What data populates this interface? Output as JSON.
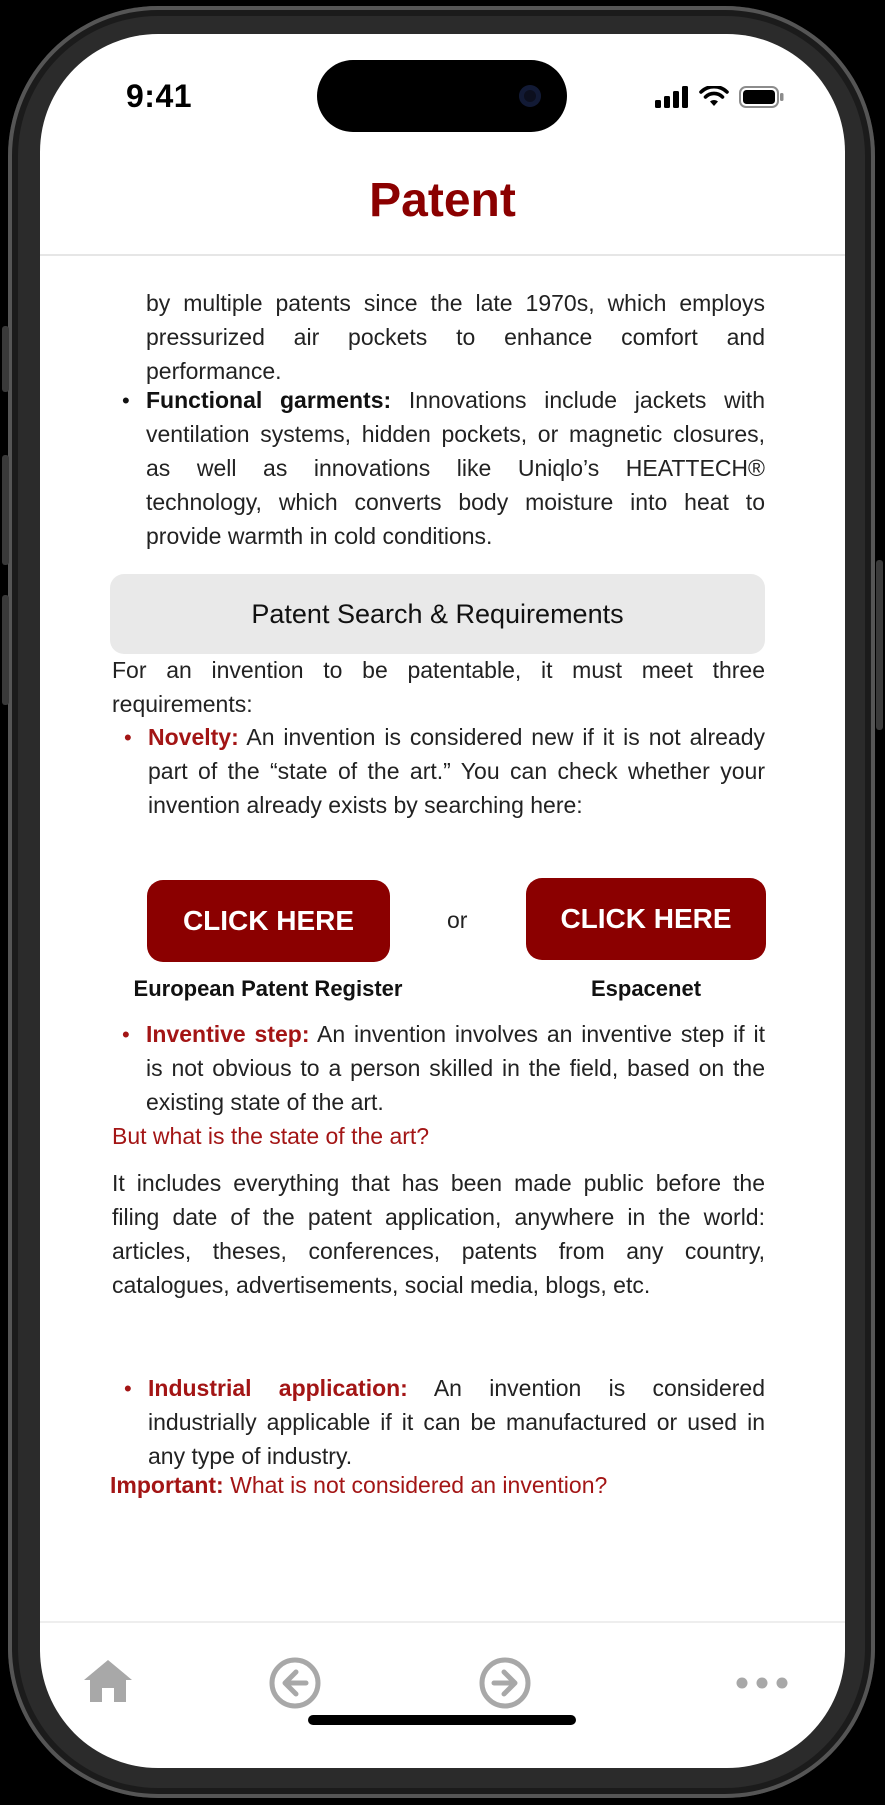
{
  "status": {
    "time": "9:41"
  },
  "header": {
    "title": "Patent"
  },
  "content": {
    "intro_lines": [
      "by multiple patents since the late 1970s, which employs pressurized air pockets to enhance comfort and performance."
    ],
    "functional": {
      "label": "Functional garments:",
      "text": " Innovations include jackets with ventilation systems, hidden pockets, or magnetic closures, as well as innovations like Uniqlo’s HEATTECH® technology, which converts body moisture into heat to provide warmth in cold conditions."
    },
    "section_title": "Patent Search & Requirements",
    "requirements_intro": "For an invention to be patentable, it must meet three requirements:",
    "novelty": {
      "label": "Novelty:",
      "text": " An invention is considered new if it is not already part of the “state of the art.” You can check whether your invention already exists by searching here:"
    },
    "buttons": {
      "left_label": "CLICK HERE",
      "left_caption": "European Patent Register",
      "or": "or",
      "right_label": "CLICK HERE",
      "right_caption": "Espacenet"
    },
    "inventive": {
      "label": "Inventive step:",
      "text": " An invention involves an inventive step if it is not obvious to a person skilled in the field, based on the existing state of the art."
    },
    "state_question": "But what is the state of the art?",
    "state_answer": "It includes everything that has been made public before the filing date of the patent application, anywhere in the world: articles, theses, conferences, patents from any country, catalogues, advertisements, social media, blogs, etc.",
    "industrial": {
      "label": "Industrial application:",
      "text": " An invention is considered industrially applicable if it can be manufactured or used in any type of industry."
    },
    "important": {
      "label": "Important:",
      "text": " What is not considered an invention?"
    }
  },
  "tabbar": {
    "home_icon": "home-icon",
    "back_icon": "arrow-left-circle-icon",
    "forward_icon": "arrow-right-circle-icon",
    "more_icon": "more-horizontal-icon"
  },
  "colors": {
    "accent": "#8b0000",
    "accent_text": "#a31515",
    "section_bg": "#e9e9e9"
  }
}
